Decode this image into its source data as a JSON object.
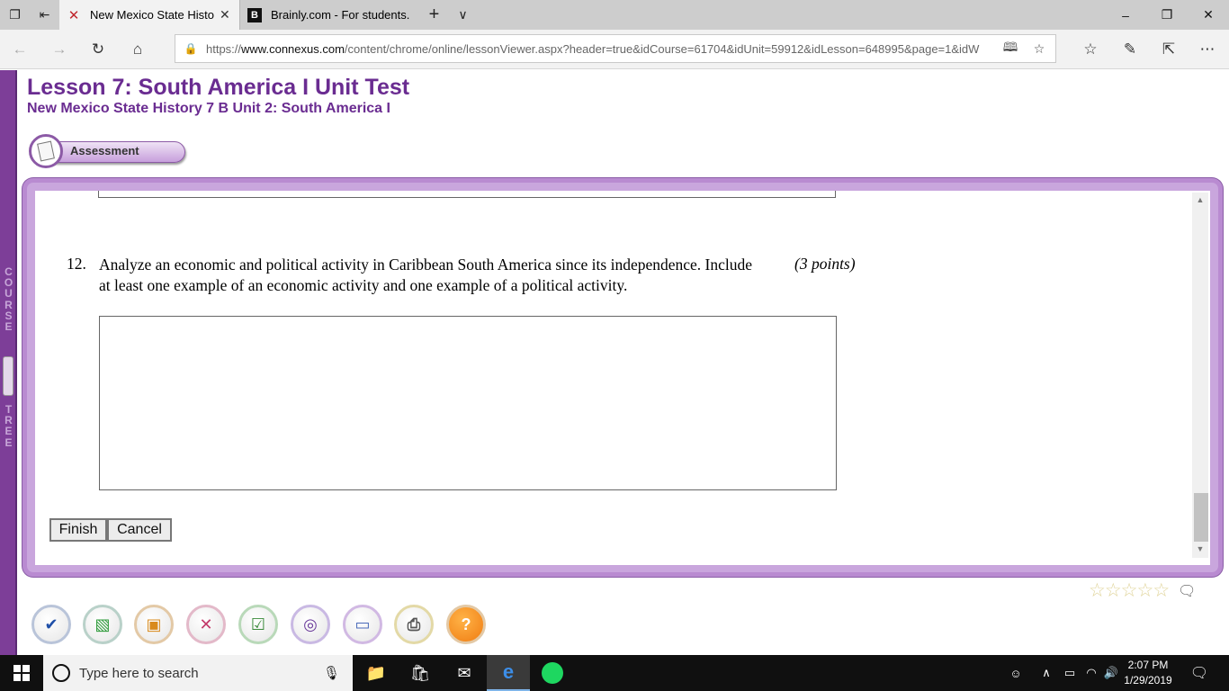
{
  "browser": {
    "tabs": [
      {
        "title": "New Mexico State Histo",
        "active": true,
        "favicon": "connexus-icon"
      },
      {
        "title": "Brainly.com - For students.",
        "active": false,
        "favicon": "brainly-icon"
      }
    ],
    "url_prefix": "https://",
    "url_domain": "www.connexus.com",
    "url_path": "/content/chrome/online/lessonViewer.aspx?header=true&idCourse=61704&idUnit=59912&idLesson=648995&page=1&idW"
  },
  "page": {
    "lesson_title": "Lesson 7: South America I Unit Test",
    "course_subtitle": "New Mexico State History 7 B  Unit 2: South America I",
    "assessment_label": "Assessment",
    "course_tree_top": "COURSE",
    "course_tree_bottom": "TREE"
  },
  "question": {
    "number": "12.",
    "text": "Analyze an economic and political activity in Caribbean South America since its independence. Include at least one example of an economic activity and one example of a political activity.",
    "points": "(3 points)",
    "answer_value": ""
  },
  "buttons": {
    "finish": "Finish",
    "cancel": "Cancel"
  },
  "rating": {
    "stars": 5
  },
  "taskbar": {
    "search_placeholder": "Type here to search",
    "time": "2:07 PM",
    "date": "1/29/2019"
  },
  "colors": {
    "brand_purple": "#6a2c91",
    "frame_purple": "#b98bd1",
    "taskbar": "#101010"
  }
}
